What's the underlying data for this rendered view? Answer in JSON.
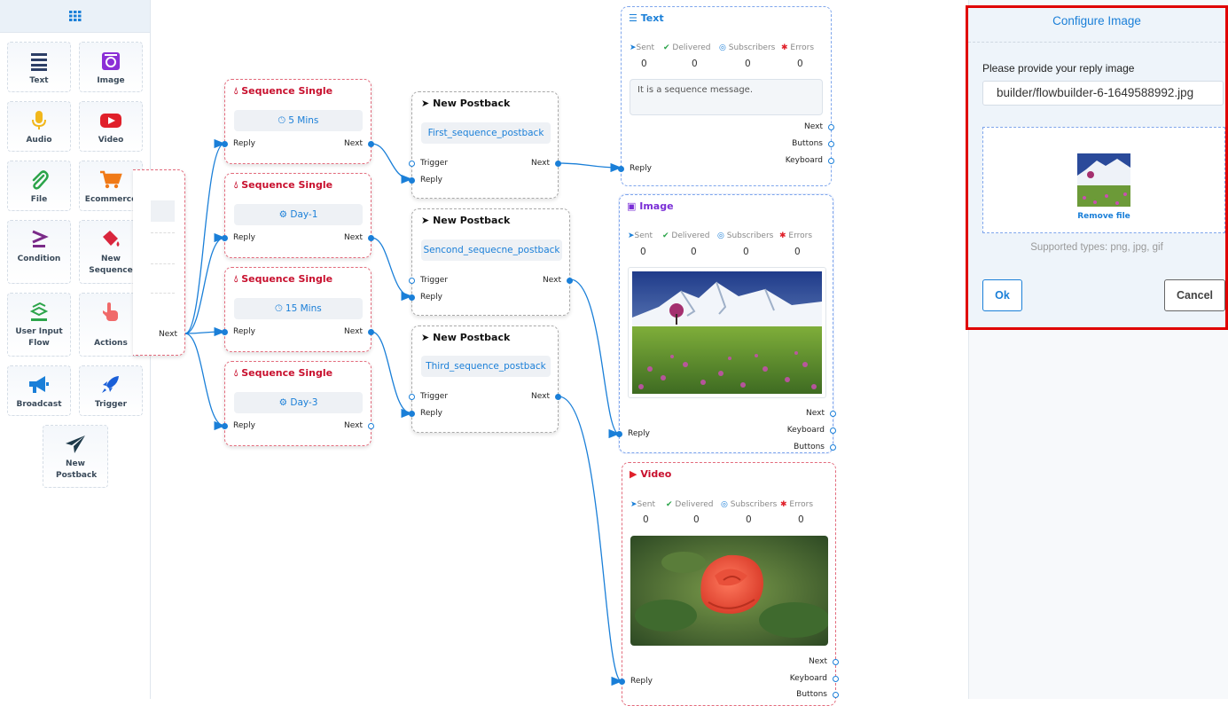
{
  "palette": {
    "header_icon": "grid-icon",
    "tiles": [
      {
        "label": "Text",
        "icon": "text-lines-icon",
        "color": "#2c3e66"
      },
      {
        "label": "Image",
        "icon": "image-icon",
        "color": "#8b2fd6"
      },
      {
        "label": "Audio",
        "icon": "microphone-icon",
        "color": "#f1b71c"
      },
      {
        "label": "Video",
        "icon": "youtube-icon",
        "color": "#e0202a"
      },
      {
        "label": "File",
        "icon": "paperclip-icon",
        "color": "#2ca44a"
      },
      {
        "label": "Ecommerce",
        "icon": "cart-icon",
        "color": "#f07a17"
      },
      {
        "label": "Condition",
        "icon": "greater-equal-icon",
        "color": "#7a2a88"
      },
      {
        "label": "New Sequence",
        "icon": "paint-bucket-icon",
        "color": "#d9263d"
      },
      {
        "label": "User Input Flow",
        "icon": "stack-icon",
        "color": "#2ca44a"
      },
      {
        "label": "Actions",
        "icon": "pointer-hand-icon",
        "color": "#f06a6a"
      },
      {
        "label": "Broadcast",
        "icon": "megaphone-icon",
        "color": "#1a7fd8"
      },
      {
        "label": "Trigger",
        "icon": "rocket-icon",
        "color": "#1a5fd8"
      },
      {
        "label": "New Postback",
        "icon": "paper-plane-icon",
        "color": "#1e3a4a"
      }
    ]
  },
  "labels": {
    "reply": "Reply",
    "next": "Next",
    "trigger": "Trigger",
    "buttons": "Buttons",
    "keyboard": "Keyboard"
  },
  "sequences": [
    {
      "title": "Sequence Single",
      "delay": "5 Mins",
      "icon": "clock-icon"
    },
    {
      "title": "Sequence Single",
      "delay": "Day-1",
      "icon": "gear-icon"
    },
    {
      "title": "Sequence Single",
      "delay": "15 Mins",
      "icon": "clock-icon"
    },
    {
      "title": "Sequence Single",
      "delay": "Day-3",
      "icon": "gear-icon"
    }
  ],
  "postbacks": [
    {
      "title": "New Postback",
      "value": "First_sequence_postback"
    },
    {
      "title": "New Postback",
      "value": "Sencond_sequecne_postback"
    },
    {
      "title": "New Postback",
      "value": "Third_sequence_postback"
    }
  ],
  "stats_labels": {
    "sent": "Sent",
    "delivered": "Delivered",
    "subscribers": "Subscribers",
    "errors": "Errors"
  },
  "text_node": {
    "title": "Text",
    "message": "It is a sequence message.",
    "sent": "0",
    "delivered": "0",
    "subscribers": "0",
    "errors": "0"
  },
  "image_node": {
    "title": "Image",
    "sent": "0",
    "delivered": "0",
    "subscribers": "0",
    "errors": "0"
  },
  "video_node": {
    "title": "Video",
    "sent": "0",
    "delivered": "0",
    "subscribers": "0",
    "errors": "0"
  },
  "config": {
    "title": "Configure Image",
    "prompt": "Please provide your reply image",
    "filename": "builder/flowbuilder-6-1649588992.jpg",
    "remove": "Remove file",
    "supported": "Supported types: png, jpg, gif",
    "ok": "Ok",
    "cancel": "Cancel"
  },
  "colors": {
    "accent": "#1a7fd8",
    "sequence": "#c8102e",
    "highlight": "#e00000"
  }
}
